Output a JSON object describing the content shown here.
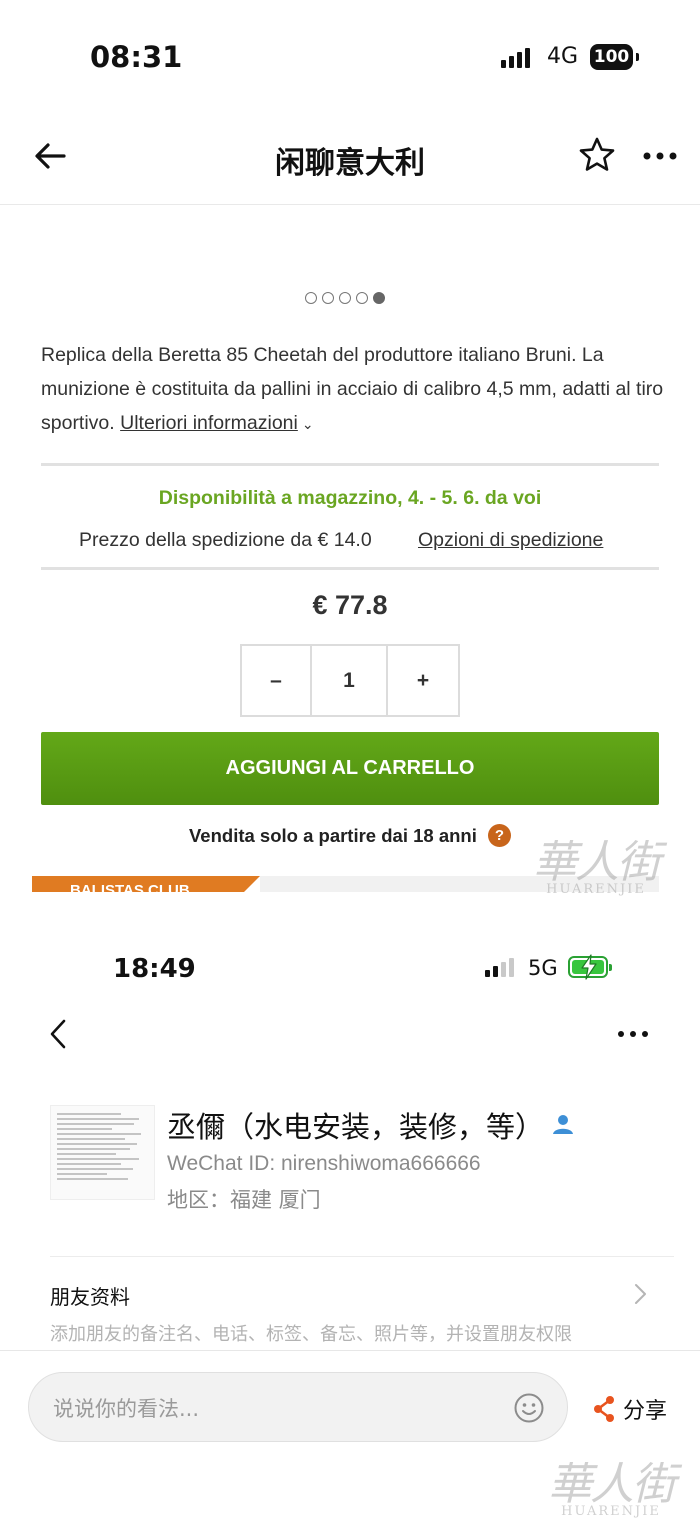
{
  "screen1": {
    "status": {
      "time": "08:31",
      "network": "4G",
      "battery": "100"
    },
    "nav": {
      "title": "闲聊意大利"
    },
    "carousel": {
      "count": 5,
      "active": 5
    },
    "description": {
      "text": "Replica della Beretta 85 Cheetah del produttore italiano Bruni. La munizione è costituita da pallini in acciaio di calibro 4,5 mm, adatti al tiro sportivo.",
      "more_label": "Ulteriori informazioni"
    },
    "availability": "Disponibilità a magazzino, 4. - 5. 6. da voi",
    "shipping": {
      "price_text": "Prezzo della spedizione da € 14.0",
      "options_label": "Opzioni di spedizione"
    },
    "price": "€ 77.8",
    "quantity": {
      "minus": "–",
      "value": "1",
      "plus": "+"
    },
    "add_to_cart": "AGGIUNGI AL CARRELLO",
    "age_notice": "Vendita solo a partire dai 18 anni",
    "age_help": "?",
    "club_banner": "BALISTAS CLUB",
    "watermark": {
      "cn": "華人街",
      "en": "HUARENJIE"
    },
    "colors": {
      "availability": "#6aa622",
      "cart_button": "#5a9d14",
      "help_badge": "#c8651b"
    }
  },
  "screen2": {
    "status": {
      "time": "18:49",
      "network": "5G"
    },
    "profile": {
      "name": "丞儞（水电安装，装修，等）",
      "wechat_id": "WeChat ID: nirenshiwoma666666",
      "region": "地区：福建 厦门"
    },
    "friend_info": {
      "title": "朋友资料",
      "description": "添加朋友的备注名、电话、标签、备忘、照片等，并设置朋友权限"
    },
    "comment": {
      "placeholder": "说说你的看法..."
    },
    "share_label": "分享",
    "watermark": {
      "cn": "華人街",
      "en": "HUARENJIE"
    },
    "colors": {
      "share_icon": "#e8541f",
      "verified_icon": "#3d8fd6",
      "battery": "#38c63e"
    }
  }
}
